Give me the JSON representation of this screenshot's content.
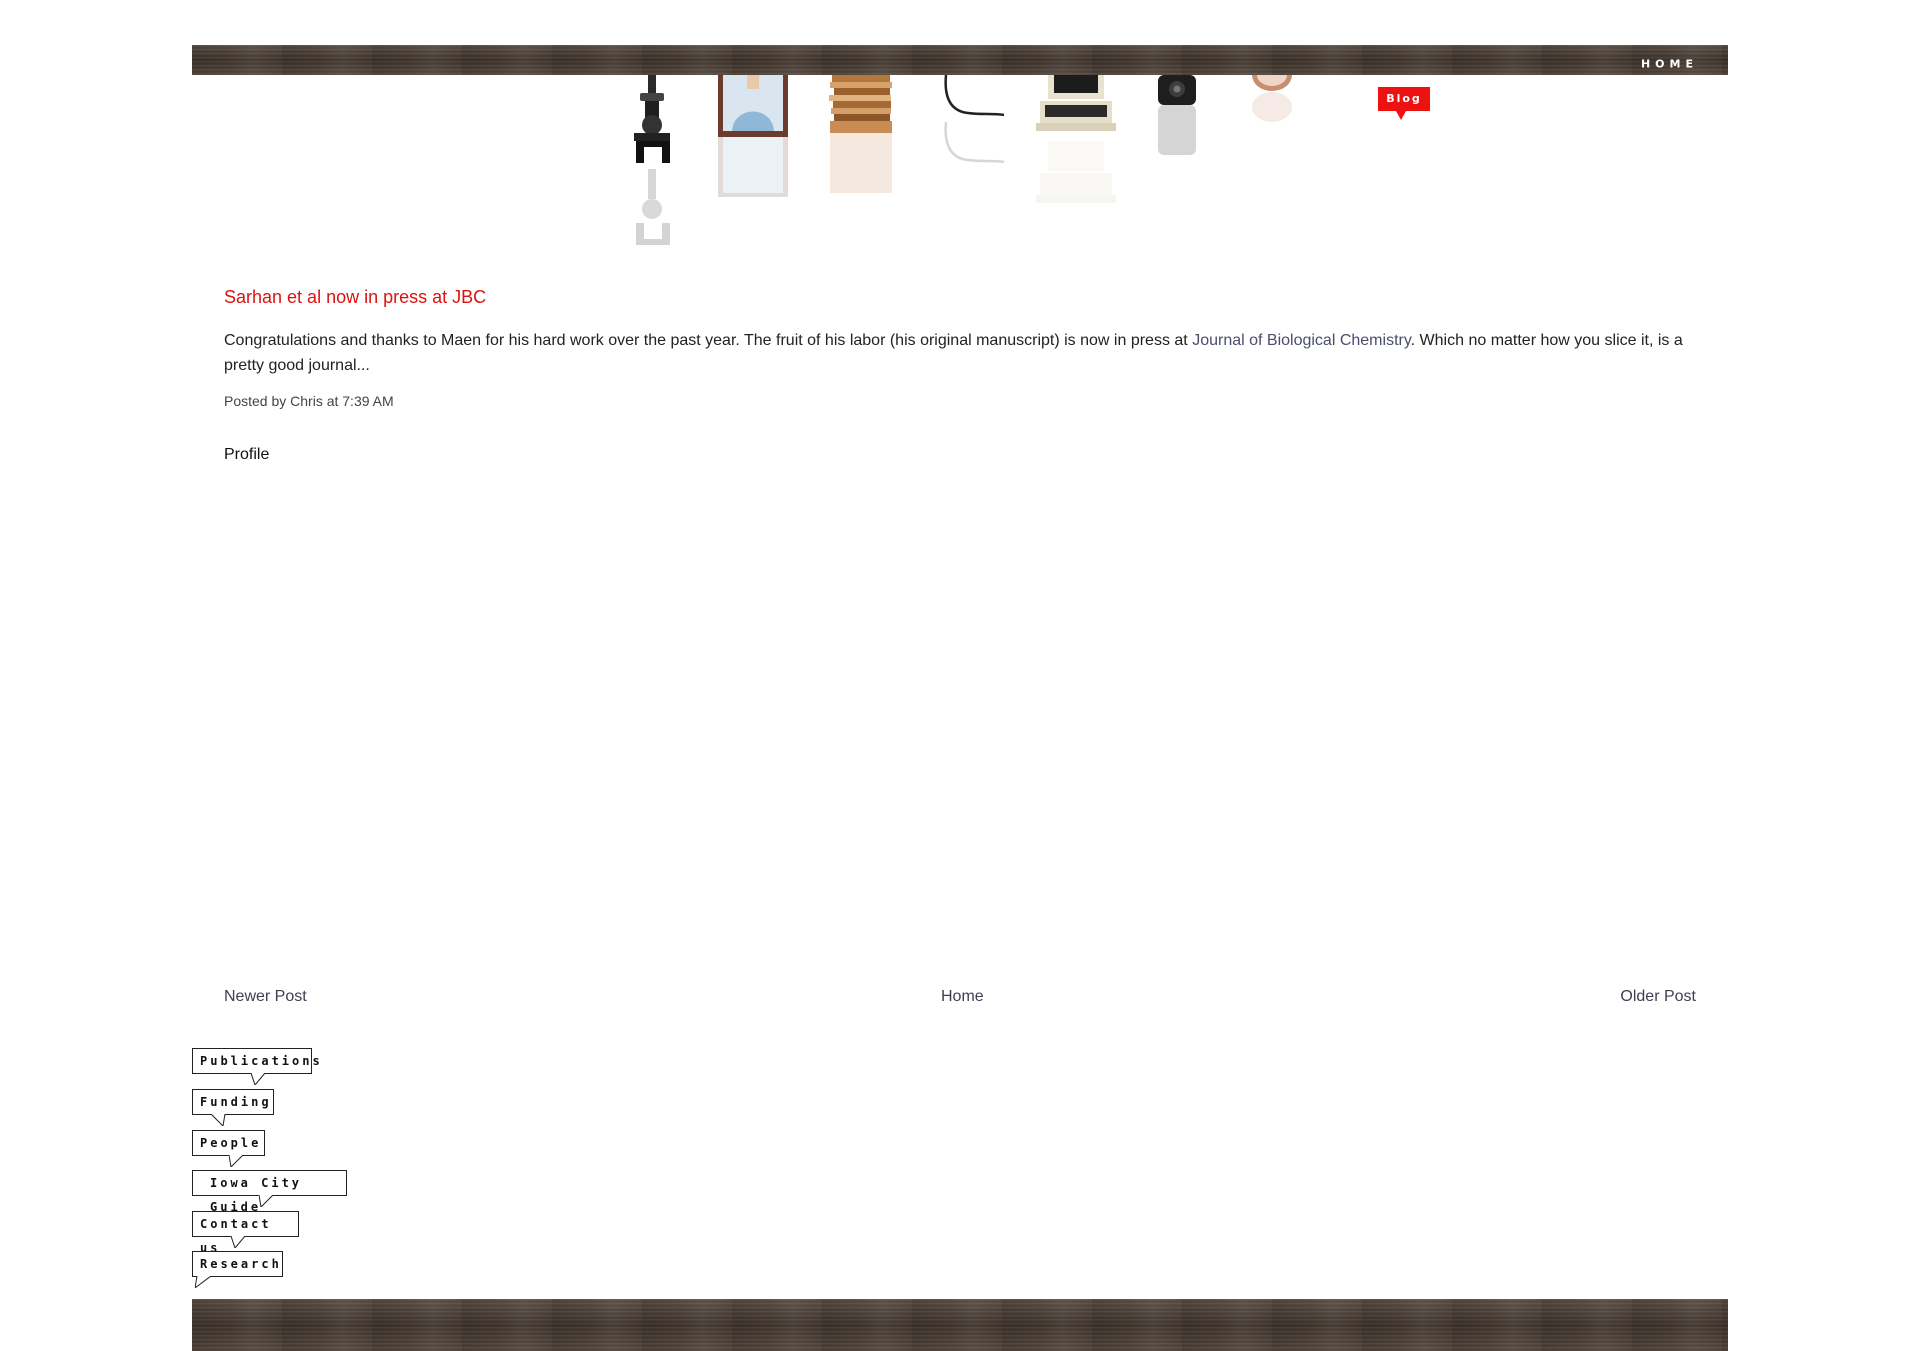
{
  "nav": {
    "home_label": "HOME",
    "blog_label": "Blog"
  },
  "post": {
    "title": "Sarhan et al now in press at JBC",
    "body_part1": "Congratulations and thanks to Maen for his hard work over the past year. The fruit of his labor (his original manuscript) is now in press at ",
    "link_text": "Journal of Biological Chemistry",
    "body_part2": ". Which no matter how you slice it, is a pretty good journal...",
    "meta": "Posted by Chris at 7:39 AM"
  },
  "profile_label": "Profile",
  "pager": {
    "newer": "Newer Post",
    "home": "Home",
    "older": "Older Post"
  },
  "sidebar": {
    "items": [
      {
        "label": "Publications"
      },
      {
        "label": "Funding"
      },
      {
        "label": "People"
      },
      {
        "label": "Iowa City Guide"
      },
      {
        "label": "Contact us"
      },
      {
        "label": "Research"
      }
    ]
  },
  "icons": [
    "microscope-icon",
    "portrait-icon",
    "papers-stack-icon",
    "cable-icon",
    "computer-icon",
    "speaker-icon",
    "clock-icon"
  ],
  "colors": {
    "accent": "#ee1111",
    "wood": "#4a3f36",
    "link": "#4a4e6a"
  }
}
